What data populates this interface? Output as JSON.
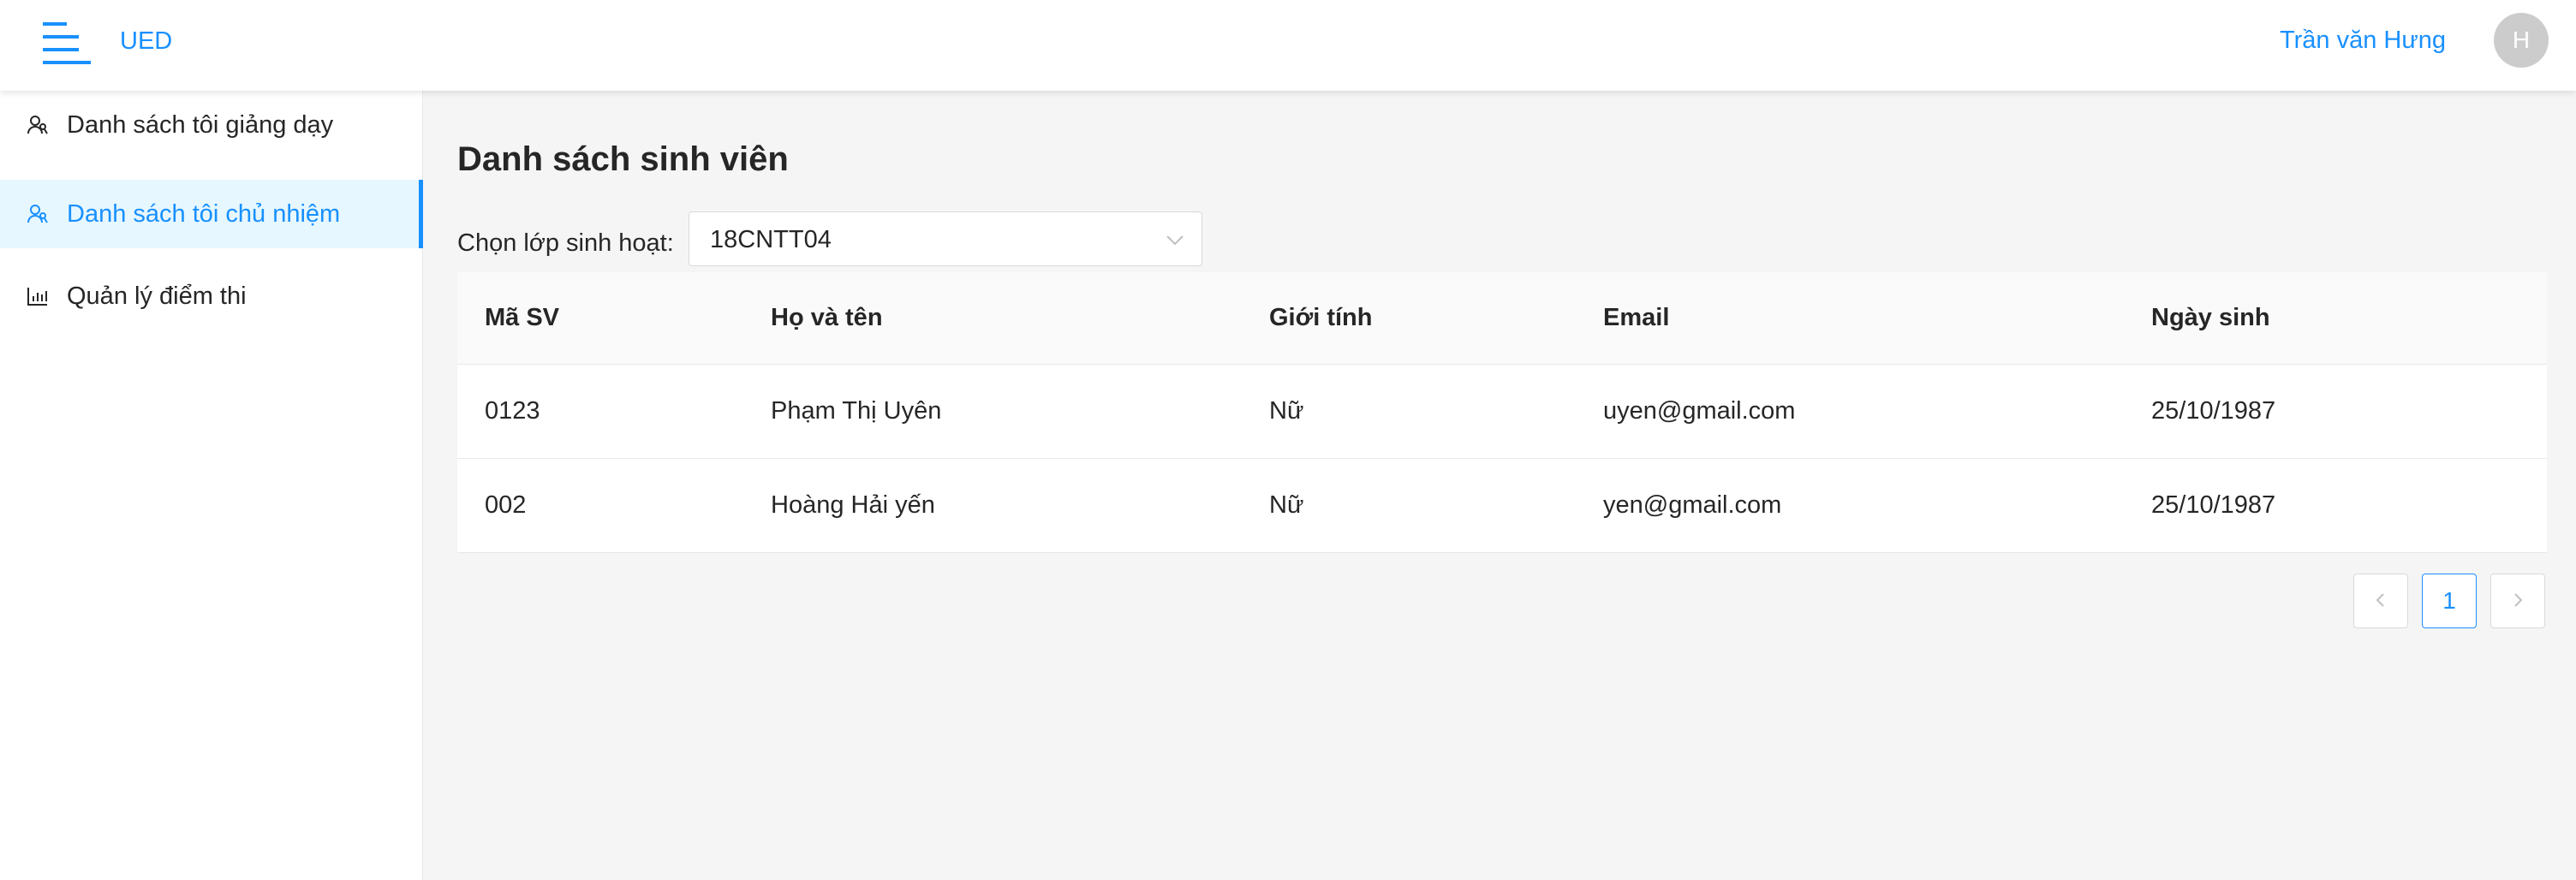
{
  "header": {
    "brand": "UED",
    "username": "Trần văn Hưng",
    "avatar_initial": "H",
    "accent_color": "#1890ff"
  },
  "sidebar": {
    "items": [
      {
        "label": "Danh sách tôi giảng dạy",
        "icon": "users-icon",
        "active": false
      },
      {
        "label": "Danh sách tôi chủ nhiệm",
        "icon": "users-icon",
        "active": true
      },
      {
        "label": "Quản lý điểm thi",
        "icon": "bar-chart-icon",
        "active": false
      }
    ]
  },
  "main": {
    "title": "Danh sách sinh viên",
    "filter": {
      "label": "Chọn lớp sinh hoạt:",
      "selected": "18CNTT04"
    },
    "table": {
      "columns": [
        "Mã SV",
        "Họ và tên",
        "Giới tính",
        "Email",
        "Ngày sinh"
      ],
      "rows": [
        [
          "0123",
          "Phạm Thị Uyên",
          "Nữ",
          "uyen@gmail.com",
          "25/10/1987"
        ],
        [
          "002",
          "Hoàng Hải yến",
          "Nữ",
          "yen@gmail.com",
          "25/10/1987"
        ]
      ]
    },
    "pagination": {
      "current_page": "1",
      "prev_icon": "chevron-left-icon",
      "next_icon": "chevron-right-icon"
    }
  }
}
